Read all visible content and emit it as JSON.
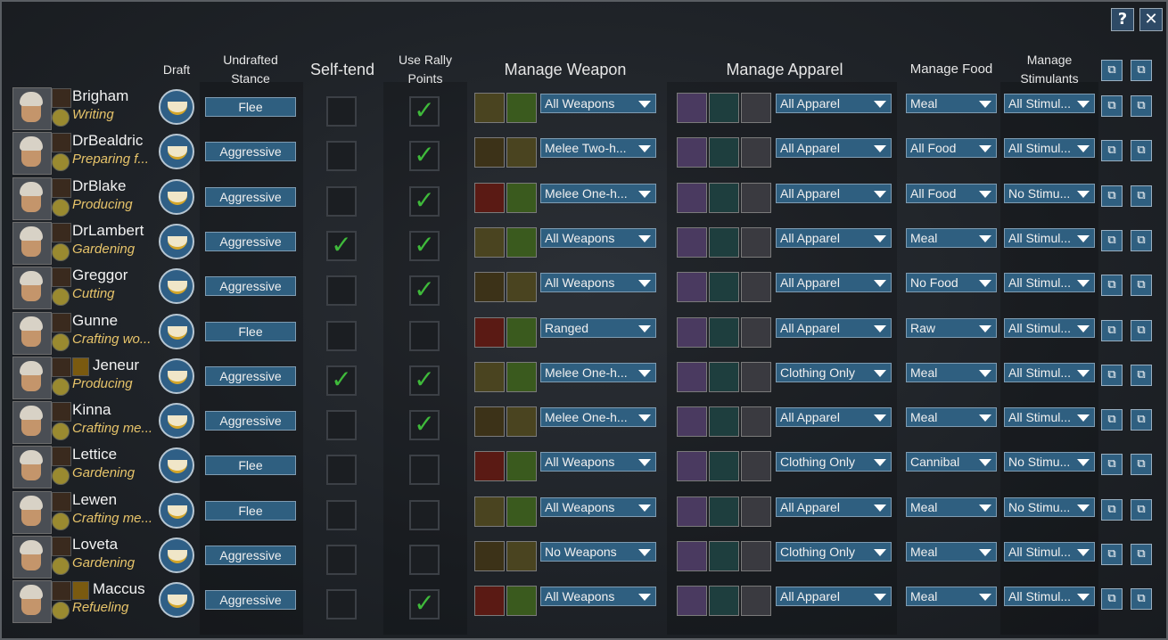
{
  "window": {
    "help_label": "?",
    "close_label": "✕"
  },
  "headers": {
    "draft": "Draft",
    "undrafted_stance": [
      "Undrafted",
      "Stance"
    ],
    "self_tend": "Self-tend",
    "use_rally_points": [
      "Use Rally",
      "Points"
    ],
    "manage_weapon": "Manage Weapon",
    "manage_apparel": "Manage Apparel",
    "manage_food": "Manage Food",
    "manage_stimulants": [
      "Manage",
      "Stimulants"
    ]
  },
  "colors": {
    "button_blue": "#2f5f80",
    "check_green": "#3fba3b",
    "job_text": "#e7c46a"
  },
  "pawns": [
    {
      "name": "Brigham",
      "job": "Writing",
      "stance": "Flee",
      "self_tend": false,
      "rally": true,
      "weapon": "All Weapons",
      "apparel": "All Apparel",
      "food": "Meal",
      "stim": "All Stimul...",
      "faction_icon": false
    },
    {
      "name": "DrBealdric",
      "job": "Preparing f...",
      "stance": "Aggressive",
      "self_tend": false,
      "rally": true,
      "weapon": "Melee Two-h...",
      "apparel": "All Apparel",
      "food": "All Food",
      "stim": "All Stimul...",
      "faction_icon": false
    },
    {
      "name": "DrBlake",
      "job": "Producing",
      "stance": "Aggressive",
      "self_tend": false,
      "rally": true,
      "weapon": "Melee One-h...",
      "apparel": "All Apparel",
      "food": "All Food",
      "stim": "No Stimu...",
      "faction_icon": false
    },
    {
      "name": "DrLambert",
      "job": "Gardening",
      "stance": "Aggressive",
      "self_tend": true,
      "rally": true,
      "weapon": "All Weapons",
      "apparel": "All Apparel",
      "food": "Meal",
      "stim": "All Stimul...",
      "faction_icon": false
    },
    {
      "name": "Greggor",
      "job": "Cutting",
      "stance": "Aggressive",
      "self_tend": false,
      "rally": true,
      "weapon": "All Weapons",
      "apparel": "All Apparel",
      "food": "No Food",
      "stim": "All Stimul...",
      "faction_icon": false
    },
    {
      "name": "Gunne",
      "job": "Crafting wo...",
      "stance": "Flee",
      "self_tend": false,
      "rally": false,
      "weapon": "Ranged",
      "apparel": "All Apparel",
      "food": "Raw",
      "stim": "All Stimul...",
      "faction_icon": false
    },
    {
      "name": "Jeneur",
      "job": "Producing",
      "stance": "Aggressive",
      "self_tend": true,
      "rally": true,
      "weapon": "Melee One-h...",
      "apparel": "Clothing Only",
      "food": "Meal",
      "stim": "All Stimul...",
      "faction_icon": true
    },
    {
      "name": "Kinna",
      "job": "Crafting me...",
      "stance": "Aggressive",
      "self_tend": false,
      "rally": true,
      "weapon": "Melee One-h...",
      "apparel": "All Apparel",
      "food": "Meal",
      "stim": "All Stimul...",
      "faction_icon": false
    },
    {
      "name": "Lettice",
      "job": "Gardening",
      "stance": "Flee",
      "self_tend": false,
      "rally": false,
      "weapon": "All Weapons",
      "apparel": "Clothing Only",
      "food": "Cannibal",
      "stim": "No Stimu...",
      "faction_icon": false
    },
    {
      "name": "Lewen",
      "job": "Crafting me...",
      "stance": "Flee",
      "self_tend": false,
      "rally": false,
      "weapon": "All Weapons",
      "apparel": "All Apparel",
      "food": "Meal",
      "stim": "No Stimu...",
      "faction_icon": false
    },
    {
      "name": "Loveta",
      "job": "Gardening",
      "stance": "Aggressive",
      "self_tend": false,
      "rally": false,
      "weapon": "No Weapons",
      "apparel": "Clothing Only",
      "food": "Meal",
      "stim": "All Stimul...",
      "faction_icon": false
    },
    {
      "name": "Maccus",
      "job": "Refueling",
      "stance": "Aggressive",
      "self_tend": false,
      "rally": true,
      "weapon": "All Weapons",
      "apparel": "All Apparel",
      "food": "Meal",
      "stim": "All Stimul...",
      "faction_icon": true
    }
  ]
}
